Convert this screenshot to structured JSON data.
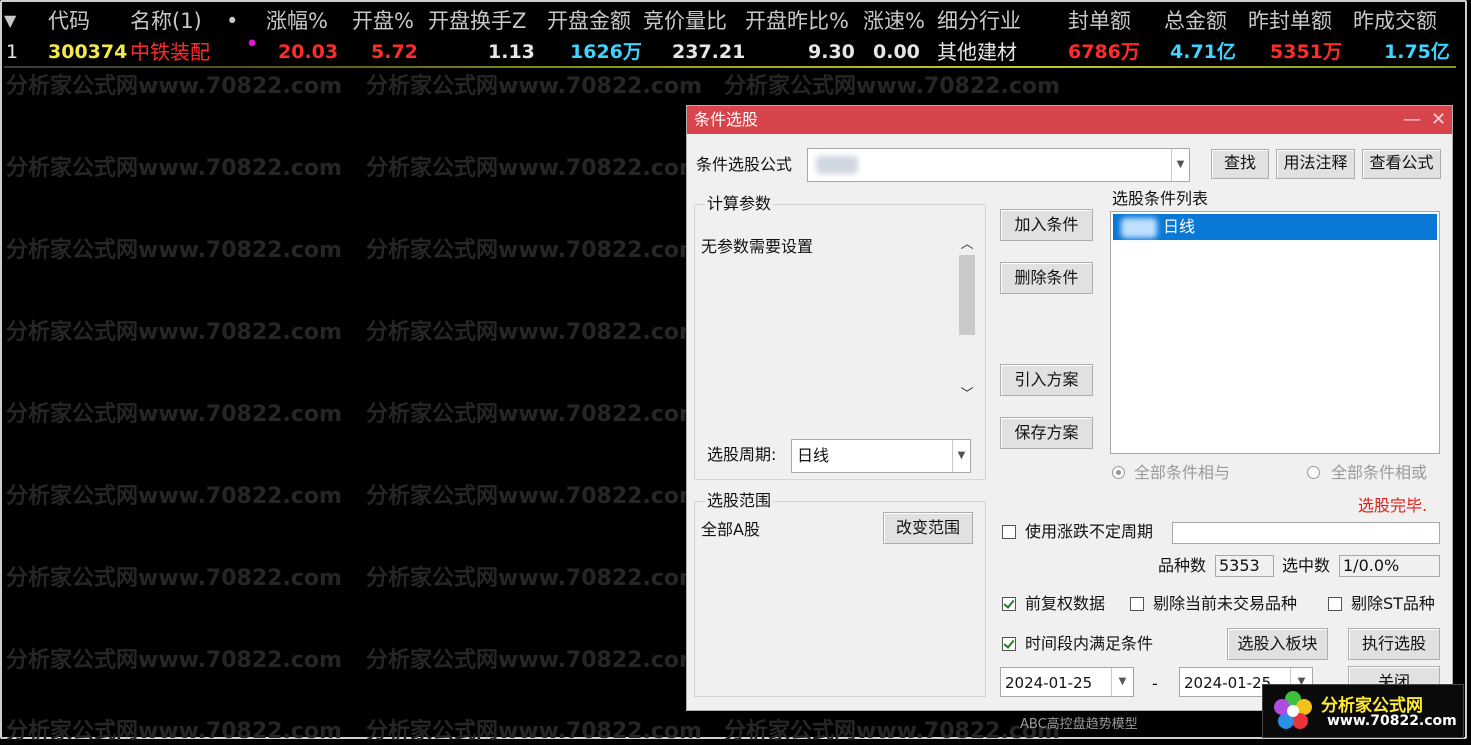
{
  "colors": {
    "red": "#ff2b2b",
    "yellow": "#f2e84a",
    "cyan": "#3fd3ff",
    "white": "#e6e6e6",
    "magenta": "#e018d6",
    "titlebar": "#d8444c",
    "done_red": "#e0201a",
    "selected": "#0a78d7"
  },
  "grid": {
    "sort_arrow": "▼",
    "columns": [
      "代码",
      "名称(1)",
      "•",
      "涨幅%",
      "开盘%",
      "开盘换手Z",
      "开盘金额",
      "竞价量比",
      "开盘昨比%",
      "涨速%",
      "细分行业",
      "封单额",
      "总金额",
      "昨封单额",
      "昨成交额"
    ],
    "row": {
      "index": "1",
      "code": "300374",
      "name": "中铁装配",
      "dot": "•",
      "change": "20.03",
      "open_pct": "5.72",
      "open_turnover": "1.13",
      "open_amount": "1626万",
      "auction_ratio": "237.21",
      "open_vs_prev": "9.30",
      "speed": "0.00",
      "industry": "其他建材",
      "seal_amount": "6786万",
      "total_amount": "4.71亿",
      "prev_seal": "5351万",
      "prev_volume": "1.75亿"
    }
  },
  "watermark": {
    "text": "分析家公式网www.70822.com"
  },
  "dialog": {
    "title": "条件选股",
    "minimize_glyph": "—",
    "close_glyph": "✕",
    "formula_label": "条件选股公式",
    "find_btn": "查找",
    "usage_btn": "用法注释",
    "view_btn": "查看公式",
    "params_group": "计算参数",
    "params_text": "无参数需要设置",
    "period_label": "选股周期:",
    "period_value": "日线",
    "add_btn": "加入条件",
    "delete_btn": "删除条件",
    "import_btn": "引入方案",
    "save_btn": "保存方案",
    "list_label": "选股条件列表",
    "list_items": [
      "日线"
    ],
    "radio_and": "全部条件相与",
    "radio_or": "全部条件相或",
    "status": "选股完毕.",
    "range_group": "选股范围",
    "range_value": "全部A股",
    "change_range_btn": "改变范围",
    "variable_period": "使用涨跌不定周期",
    "count_label": "品种数",
    "count_value": "5353",
    "selected_label": "选中数",
    "selected_value": "1/0.0%",
    "adjusted": "前复权数据",
    "exclude_untraded": "剔除当前未交易品种",
    "exclude_st": "剔除ST品种",
    "time_range": "时间段内满足条件",
    "to_block_btn": "选股入板块",
    "execute_btn": "执行选股",
    "date_from": "2024-01-25",
    "date_dash": "-",
    "date_to": "2024-01-25",
    "close_btn": "关闭"
  },
  "statusbar": {
    "text": "ABC高控盘趋势模型"
  },
  "logo": {
    "name": "分析家公式网",
    "url": "www.70822.com"
  }
}
